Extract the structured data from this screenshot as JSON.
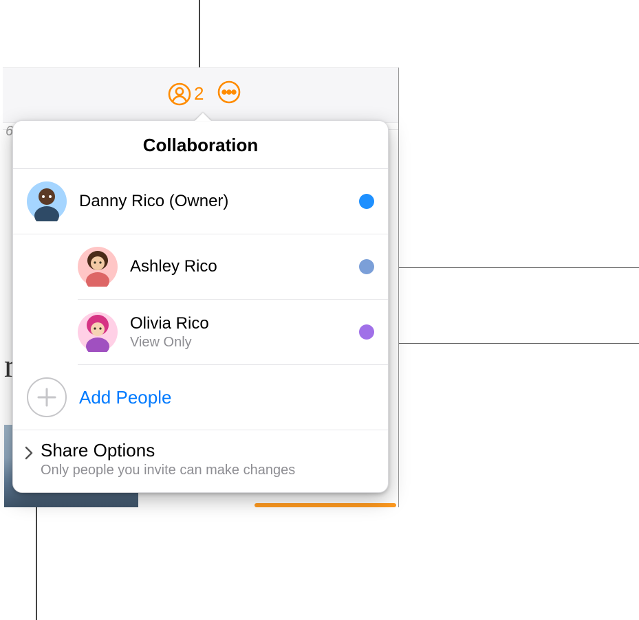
{
  "toolbar": {
    "collab_count": "2"
  },
  "popover": {
    "title": "Collaboration",
    "people": [
      {
        "name": "Danny Rico (Owner)",
        "sub": "",
        "dot": "#1e90ff",
        "avatar_bg": "#a0cfff",
        "avatar_kind": "male-dark"
      },
      {
        "name": "Ashley Rico",
        "sub": "",
        "dot": "#7b9fd8",
        "avatar_bg": "#ffc6c6",
        "avatar_kind": "female"
      },
      {
        "name": "Olivia Rico",
        "sub": "View Only",
        "dot": "#a070e8",
        "avatar_bg": "#ffd0e6",
        "avatar_kind": "female-pink"
      }
    ],
    "add_label": "Add People",
    "share": {
      "title": "Share Options",
      "sub": "Only people you invite can make changes"
    }
  },
  "bg": {
    "row_number": "6",
    "script": "r"
  }
}
